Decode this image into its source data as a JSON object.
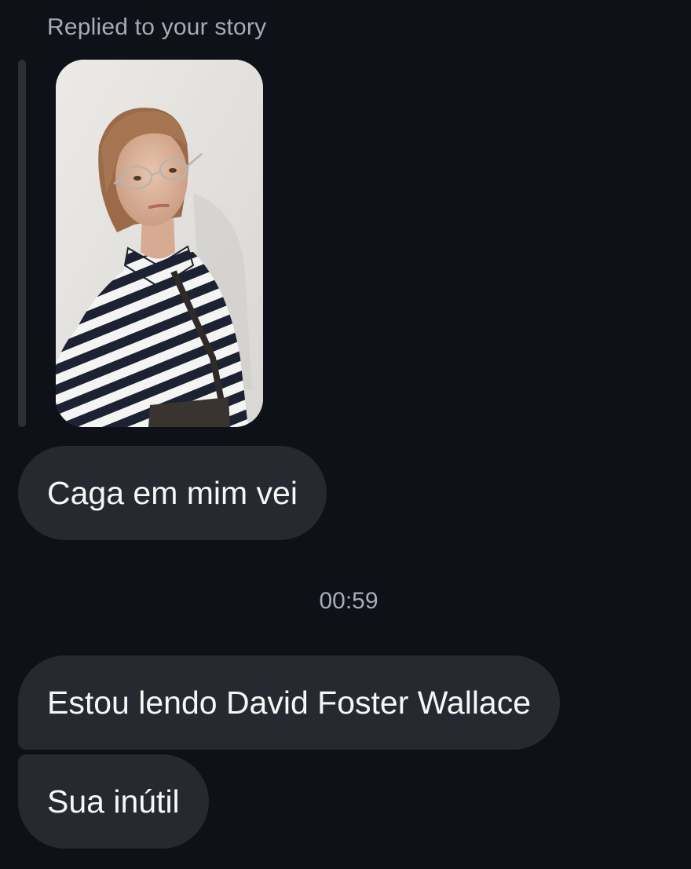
{
  "thread": {
    "reply_label": "Replied to your story",
    "story_image": {
      "description": "story-photo"
    },
    "messages": [
      {
        "text": "Caga em mim vei"
      },
      {
        "text": "Estou lendo David Foster Wallace"
      },
      {
        "text": "Sua inútil"
      }
    ],
    "timestamp": "00:59"
  },
  "colors": {
    "background": "#0e1117",
    "bubble": "#262a30",
    "secondary_text": "#a8adb5",
    "primary_text": "#f7f7f7",
    "reply_bar": "#2c3036"
  }
}
